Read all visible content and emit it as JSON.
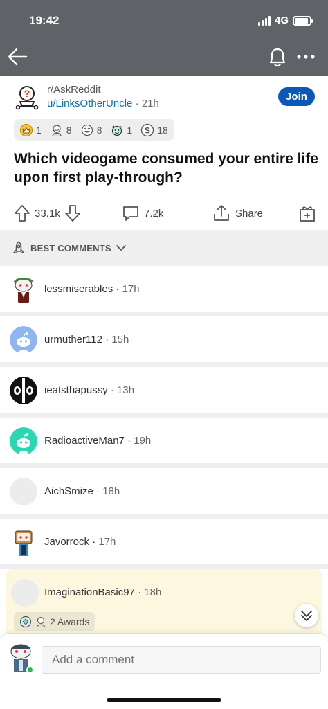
{
  "status": {
    "time": "19:42",
    "network": "4G"
  },
  "post": {
    "subreddit": "r/AskReddit",
    "author": "u/LinksOtherUncle",
    "separator": "·",
    "age": "21h",
    "join_label": "Join",
    "awards": [
      {
        "icon": "gold-award-icon",
        "count": "1"
      },
      {
        "icon": "wholesome-award-icon",
        "count": "8"
      },
      {
        "icon": "laughing-award-icon",
        "count": "8"
      },
      {
        "icon": "hugz-award-icon",
        "count": "1"
      },
      {
        "icon": "silver-award-icon",
        "count": "18"
      }
    ],
    "title": "Which videogame consumed your entire life upon first play-through?",
    "upvotes": "33.1k",
    "comments_count": "7.2k",
    "share_label": "Share"
  },
  "sort": {
    "label": "BEST COMMENTS"
  },
  "comments": [
    {
      "user": "lessmiserables",
      "time": "17h",
      "avatar": "snoo-wreath-avatar"
    },
    {
      "user": "urmuther112",
      "time": "15h",
      "avatar": "default-blue-avatar"
    },
    {
      "user": "ieatsthapussy",
      "time": "13h",
      "avatar": "black-pattern-avatar"
    },
    {
      "user": "RadioactiveMan7",
      "time": "19h",
      "avatar": "default-teal-avatar"
    },
    {
      "user": "AichSmize",
      "time": "18h",
      "avatar": "empty-avatar"
    },
    {
      "user": "Javorrock",
      "time": "17h",
      "avatar": "snoo-tv-avatar"
    },
    {
      "user": "ImaginationBasic97",
      "time": "18h",
      "avatar": "empty-avatar",
      "awards_label": "2 Awards"
    }
  ],
  "composer": {
    "placeholder": "Add a comment"
  },
  "colors": {
    "header": "#5f6368",
    "join": "#0a59b8",
    "author_link": "#0b6fb8",
    "highlight": "#fcf7de"
  }
}
